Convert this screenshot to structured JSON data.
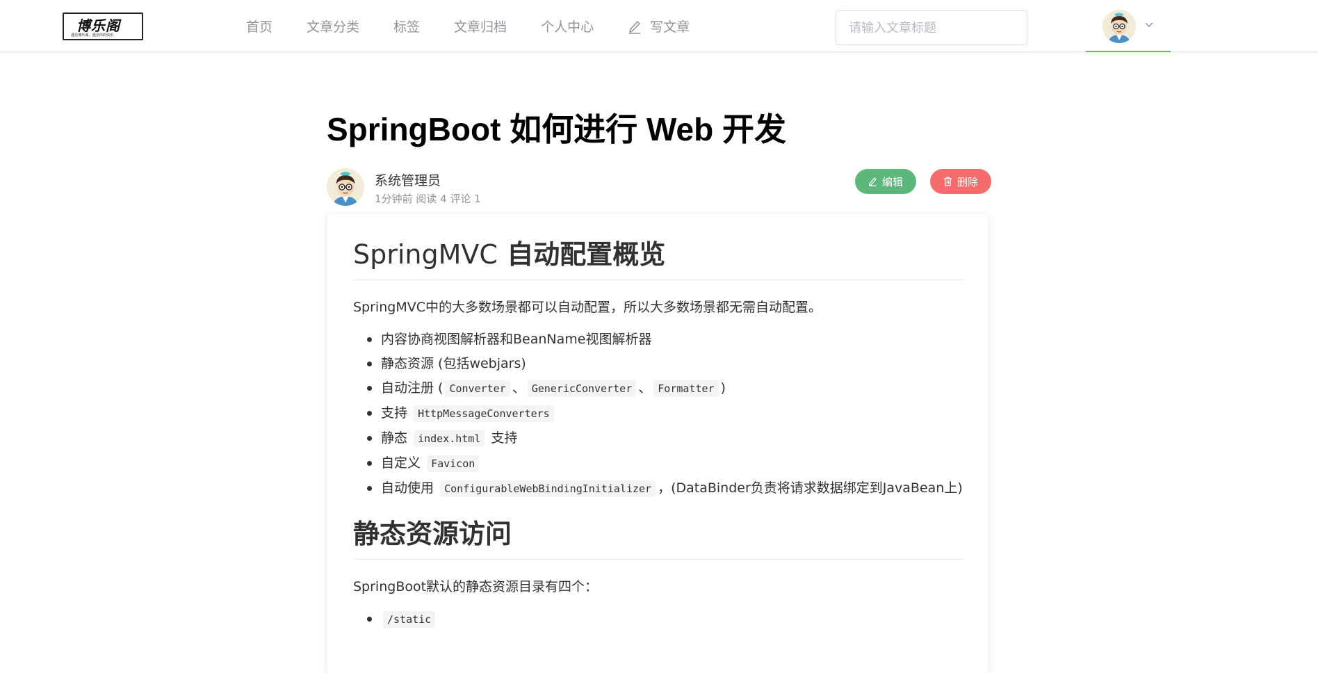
{
  "header": {
    "logo": {
      "title": "博乐阁",
      "subtitle": "遇见博乐阁、遇见你的快乐"
    },
    "nav": [
      {
        "label": "首页"
      },
      {
        "label": "文章分类"
      },
      {
        "label": "标签"
      },
      {
        "label": "文章归档"
      },
      {
        "label": "个人中心"
      },
      {
        "label": "写文章",
        "icon": "pen-icon"
      }
    ],
    "search_placeholder": "请输入文章标题",
    "active_indicator_color": "#67c23a"
  },
  "article": {
    "title": "SpringBoot 如何进行 Web 开发",
    "author": "系统管理员",
    "meta": "1分钟前 阅读 4 评论 1",
    "edit_label": "编辑",
    "delete_label": "删除",
    "edit_color": "#5cb87a",
    "delete_color": "#f56c6c"
  },
  "content": {
    "h1_a_prefix": "SpringMVC",
    "h1_a_suffix": "自动配置概览",
    "p1": "SpringMVC中的大多数场景都可以自动配置，所以大多数场景都无需自动配置。",
    "list1": {
      "item1": "内容协商视图解析器和BeanName视图解析器",
      "item2": "静态资源 (包括webjars)",
      "item3": {
        "pre": "自动注册 (",
        "code1": "Converter",
        "sep1": "、",
        "code2": "GenericConverter",
        "sep2": "、",
        "code3": "Formatter",
        "post": ")"
      },
      "item4": {
        "pre": "支持",
        "code": "HttpMessageConverters"
      },
      "item5": {
        "pre": "静态",
        "code": "index.html",
        "post": "支持"
      },
      "item6": {
        "pre": "自定义",
        "code": "Favicon"
      },
      "item7": {
        "pre": "自动使用",
        "code": "ConfigurableWebBindingInitializer",
        "post": "，(DataBinder负责将请求数据绑定到JavaBean上)"
      }
    },
    "h1_b": "静态资源访问",
    "p2": "SpringBoot默认的静态资源目录有四个：",
    "list2": {
      "item1_code": "/static"
    }
  }
}
